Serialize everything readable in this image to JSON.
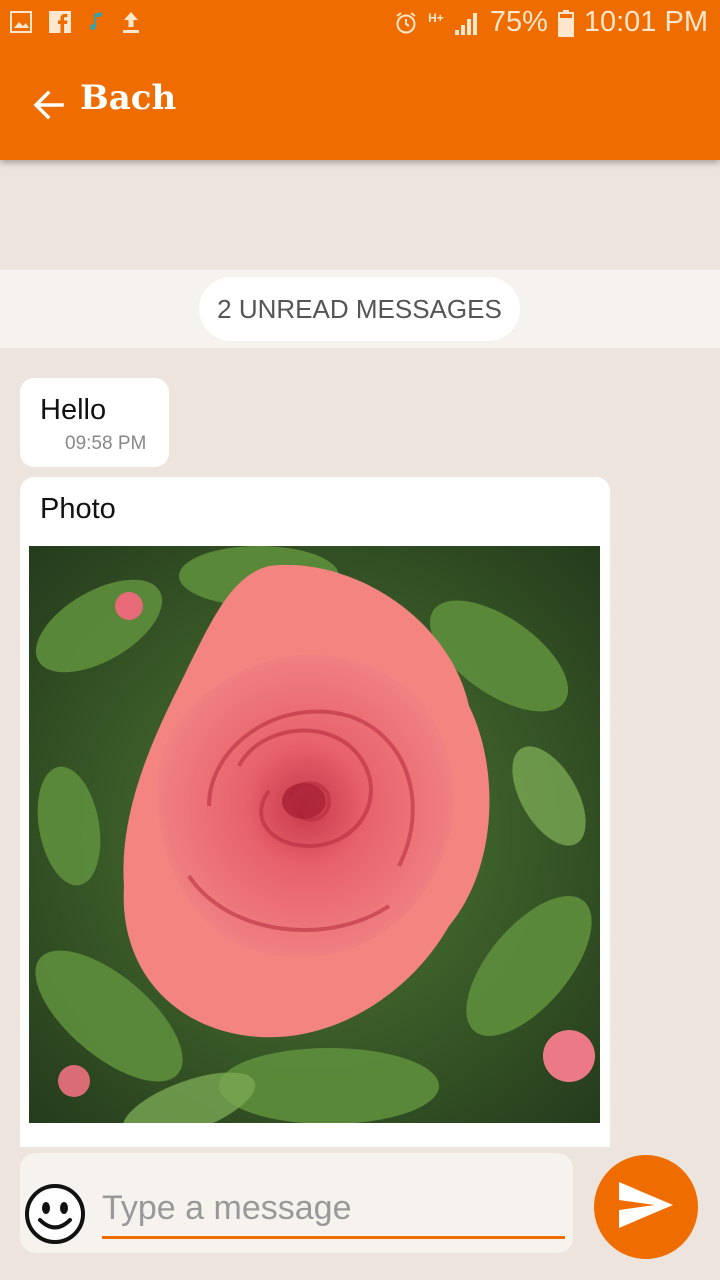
{
  "status_bar": {
    "battery": "75%",
    "time": "10:01 PM",
    "network": "H+",
    "icons": [
      "gallery-icon",
      "facebook-icon",
      "music-icon",
      "upload-icon",
      "alarm-icon",
      "signal-icon",
      "battery-icon"
    ]
  },
  "toolbar": {
    "title": "Bach",
    "back_icon": "arrow-left-icon",
    "color": "#ef6c00"
  },
  "unread_banner": "2 UNREAD MESSAGES",
  "messages": [
    {
      "text": "Hello",
      "time": "09:58 PM"
    },
    {
      "text": "Photo",
      "attachment": "rose-photo"
    }
  ],
  "composer": {
    "placeholder": "Type a message",
    "emoji_icon": "smiley-icon",
    "send_icon": "send-icon"
  }
}
